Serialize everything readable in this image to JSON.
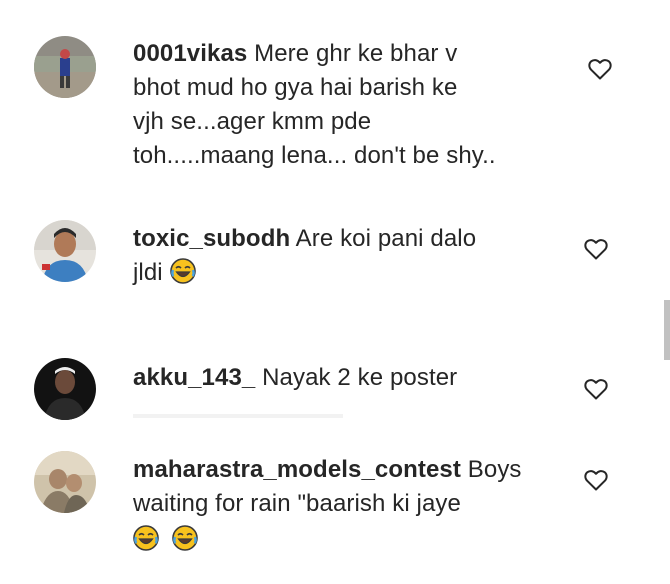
{
  "comments": [
    {
      "username": "0001vikas",
      "lines": [
        "Mere ghr ke bhar v",
        "bhot mud ho gya hai barish ke",
        "vjh se...ager kmm pde",
        "toh.....maang lena... don't be shy.."
      ]
    },
    {
      "username": "toxic_subodh",
      "lines": [
        "Are koi pani dalo",
        "jldi"
      ],
      "emoji": "face-with-tears-of-joy"
    },
    {
      "username": "akku_143_",
      "lines": [
        "Nayak 2 ke poster"
      ]
    },
    {
      "username": "maharastra_models_contest",
      "lines": [
        "Boys",
        "waiting for rain \"baarish ki jaye"
      ],
      "emoji": "face-with-tears-of-joy"
    }
  ],
  "icons": {
    "like": "heart-outline-icon",
    "emoji": "face-with-tears-of-joy"
  },
  "colors": {
    "text": "#262626",
    "emoji_face": "#f7c21e"
  }
}
